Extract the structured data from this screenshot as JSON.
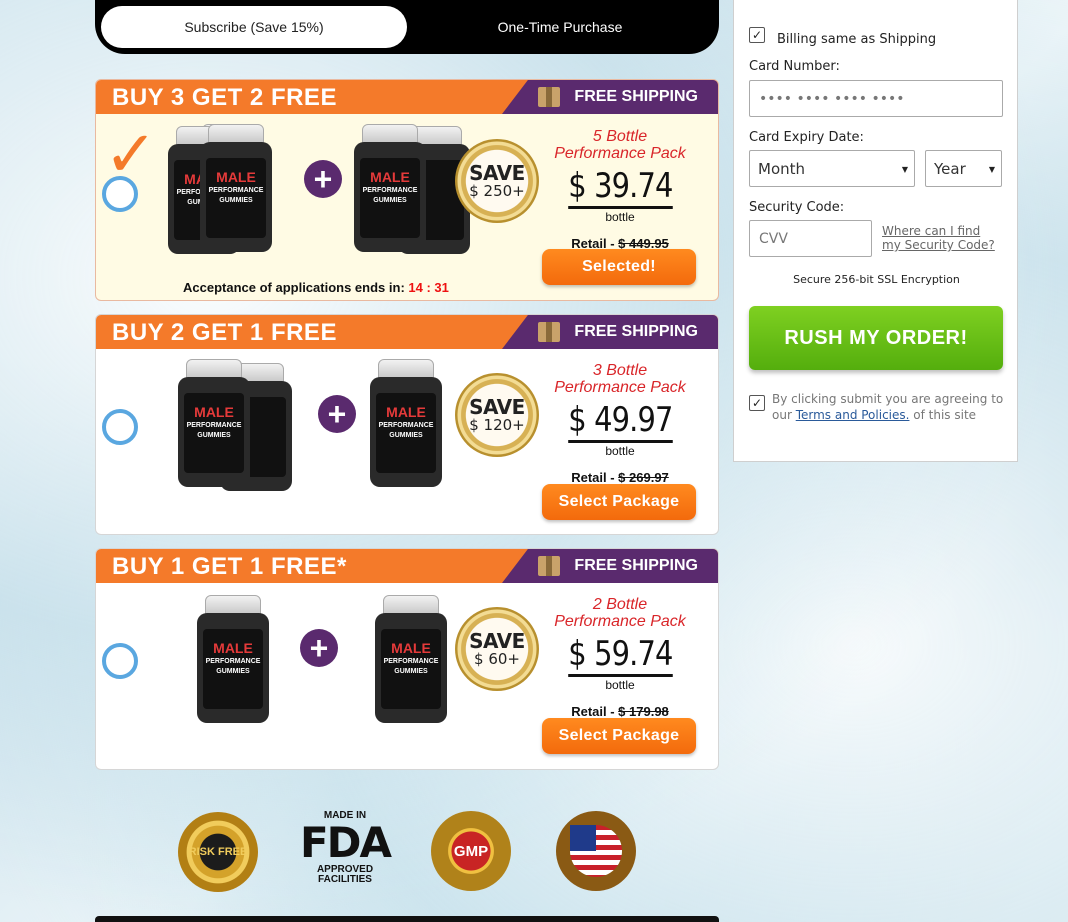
{
  "toggle": {
    "subscribe": "Subscribe (Save 15%)",
    "one_time": "One-Time Purchase"
  },
  "packages": [
    {
      "deal": "BUY 3 GET 2 FREE",
      "shipping": "FREE SHIPPING",
      "save_word": "SAVE",
      "save_amount": "$ 250+",
      "pack_line1": "5 Bottle",
      "pack_line2": "Performance Pack",
      "price": "$ 39.74",
      "unit": "bottle",
      "retail_label": "Retail - ",
      "retail_price": "$ 449.95",
      "button": "Selected!",
      "timer_label": "Acceptance of applications ends in: ",
      "timer_value": "14 : 31"
    },
    {
      "deal": "BUY 2 GET 1 FREE",
      "shipping": "FREE SHIPPING",
      "save_word": "SAVE",
      "save_amount": "$ 120+",
      "pack_line1": "3 Bottle",
      "pack_line2": "Performance Pack",
      "price": "$ 49.97",
      "unit": "bottle",
      "retail_label": "Retail - ",
      "retail_price": "$ 269.97",
      "button": "Select Package"
    },
    {
      "deal": "BUY 1 GET 1 FREE*",
      "shipping": "FREE SHIPPING",
      "save_word": "SAVE",
      "save_amount": "$ 60+",
      "pack_line1": "2 Bottle",
      "pack_line2": "Performance Pack",
      "price": "$ 59.74",
      "unit": "bottle",
      "retail_label": "Retail - ",
      "retail_price": "$ 179.98",
      "button": "Select Package"
    }
  ],
  "bottle_label": {
    "line1": "MALE",
    "line2": "PERFORMANCE",
    "line3": "GUMMIES"
  },
  "badges": {
    "risk_free": "RISK FREE",
    "fda_made": "MADE IN",
    "fda": "FDA",
    "fda_approved": "APPROVED",
    "fda_facilities": "FACILITIES",
    "gmp": "GMP"
  },
  "payment": {
    "billing_same": "Billing same as Shipping",
    "card_number_label": "Card Number:",
    "card_number_placeholder": "•••• •••• •••• ••••",
    "expiry_label": "Card Expiry Date:",
    "month": "Month",
    "year": "Year",
    "security_label": "Security Code:",
    "cvv_placeholder": "CVV",
    "find_code_1": "Where can I find",
    "find_code_2": "my Security Code?",
    "ssl": "Secure 256-bit SSL Encryption",
    "rush": "RUSH MY ORDER!",
    "agree_text": "By clicking submit you are agreeing to our ",
    "terms": "Terms and Policies.",
    "agree_end": " of this site"
  }
}
